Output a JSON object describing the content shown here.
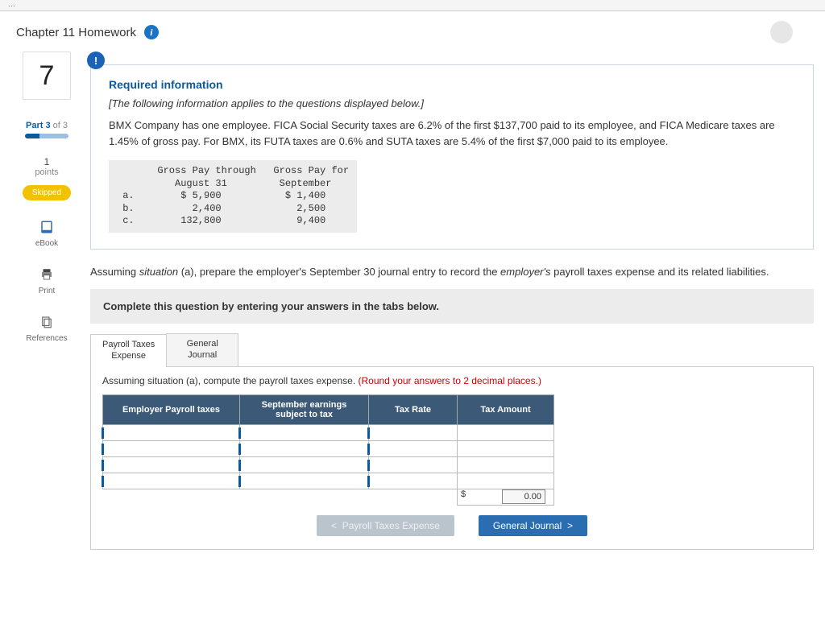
{
  "page_title": "Chapter 11 Homework",
  "question_number": "7",
  "part_label": "Part 3",
  "part_total": "of 3",
  "points_num": "1",
  "points_label": "points",
  "skipped_label": "Skipped",
  "tools": {
    "ebook": "eBook",
    "print": "Print",
    "references": "References"
  },
  "req": {
    "title": "Required information",
    "intro": "[The following information applies to the questions displayed below.]",
    "para": "BMX Company has one employee. FICA Social Security taxes are 6.2% of the first $137,700 paid to its employee, and FICA Medicare taxes are 1.45% of gross pay. For BMX, its FUTA taxes are 0.6% and SUTA taxes are 5.4% of the first $7,000 paid to its employee.",
    "table_text": "       Gross Pay through   Gross Pay for\n          August 31         September\n a.        $ 5,900           $ 1,400\n b.          2,400             2,500\n c.        132,800             9,400"
  },
  "instruction_prefix": "Assuming ",
  "instruction_situation": "situation",
  "instruction_mid1": " (a), prepare the employer's September 30 journal entry to record the ",
  "instruction_employers": "employer's",
  "instruction_mid2": " payroll taxes expense and its related liabilities.",
  "complete_prompt": "Complete this question by entering your answers in the tabs below.",
  "tabs": {
    "t1_l1": "Payroll Taxes",
    "t1_l2": "Expense",
    "t2_l1": "General",
    "t2_l2": "Journal"
  },
  "subprompt_main": "Assuming situation (a), compute the payroll taxes expense. ",
  "subprompt_note": "(Round your answers to 2 decimal places.)",
  "headers": {
    "c1": "Employer Payroll taxes",
    "c2_l1": "September earnings",
    "c2_l2": "subject to tax",
    "c3": "Tax Rate",
    "c4": "Tax Amount"
  },
  "total_currency": "$",
  "total_value": "0.00",
  "nav": {
    "prev": "Payroll Taxes Expense",
    "next": "General Journal"
  }
}
